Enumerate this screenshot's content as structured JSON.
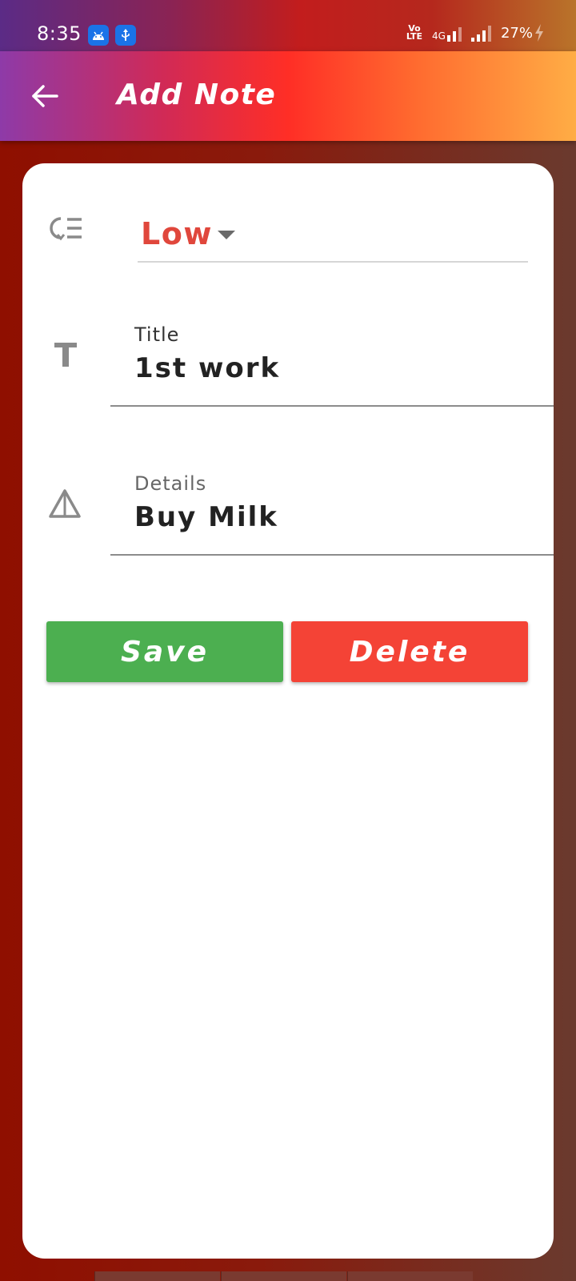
{
  "status_bar": {
    "time": "8:35",
    "network": "4G",
    "volte_top": "Vo",
    "volte_bottom": "LTE",
    "battery": "27%"
  },
  "app_bar": {
    "title": "Add Note",
    "back_icon": "arrow-left-icon"
  },
  "priority": {
    "icon": "priority-list-icon",
    "value": "Low",
    "value_color": "#e0473c"
  },
  "title_field": {
    "icon": "text-t-icon",
    "label": "Title",
    "value": "1st work"
  },
  "details_field": {
    "icon": "triangle-icon",
    "label": "Details",
    "value": "Buy Milk"
  },
  "buttons": {
    "save": "Save",
    "delete": "Delete"
  },
  "colors": {
    "save": "#4caf50",
    "delete": "#f44336"
  }
}
